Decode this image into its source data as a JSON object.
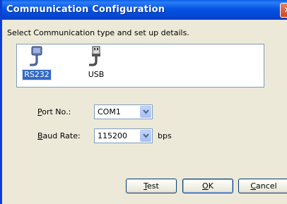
{
  "window": {
    "title": "Communication Configuration",
    "close_glyph": "✕"
  },
  "instruction": "Select Communication type and set up details.",
  "comm_types": [
    {
      "label": "RS232",
      "icon": "serial-port-icon",
      "selected": true
    },
    {
      "label": "USB",
      "icon": "usb-plug-icon",
      "selected": false
    }
  ],
  "port": {
    "label_first": "P",
    "label_rest": "ort No.:",
    "value": "COM1"
  },
  "baud": {
    "label_first": "B",
    "label_rest": "aud Rate:",
    "value": "115200",
    "unit": "bps"
  },
  "buttons": {
    "test_first": "T",
    "test_rest": "est",
    "ok_first": "O",
    "ok_rest": "K",
    "cancel_first": "C",
    "cancel_rest": "ancel"
  },
  "colors": {
    "titlebar": "#0554e3",
    "selection": "#316ac5"
  }
}
